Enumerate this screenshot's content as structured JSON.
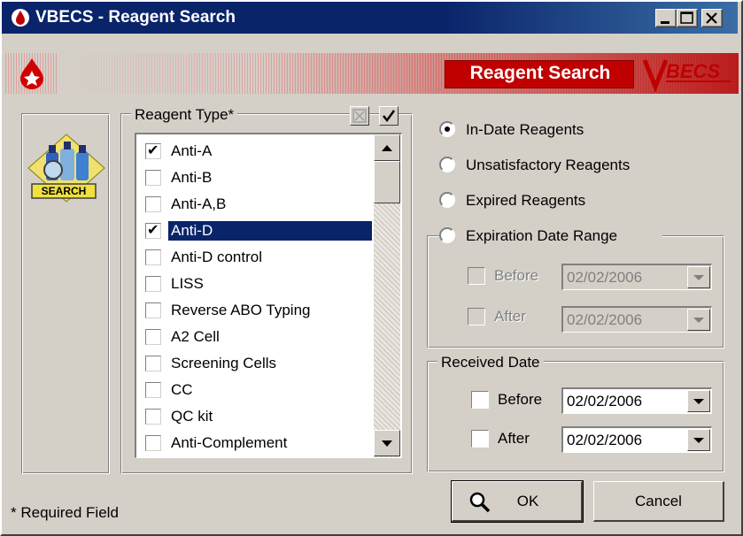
{
  "window": {
    "title": "VBECS - Reagent Search",
    "controls": [
      "minimize",
      "maximize",
      "close"
    ]
  },
  "banner": {
    "title": "Reagent Search",
    "brand": "VBECS"
  },
  "left_panel": {
    "search_button_label": "SEARCH"
  },
  "reagent_type": {
    "legend": "Reagent Type*",
    "items": [
      {
        "label": "Anti-A",
        "checked": true,
        "selected": false
      },
      {
        "label": "Anti-B",
        "checked": false,
        "selected": false
      },
      {
        "label": "Anti-A,B",
        "checked": false,
        "selected": false
      },
      {
        "label": "Anti-D",
        "checked": true,
        "selected": true
      },
      {
        "label": "Anti-D control",
        "checked": false,
        "selected": false
      },
      {
        "label": "LISS",
        "checked": false,
        "selected": false
      },
      {
        "label": "Reverse ABO Typing",
        "checked": false,
        "selected": false
      },
      {
        "label": "A2 Cell",
        "checked": false,
        "selected": false
      },
      {
        "label": "Screening Cells",
        "checked": false,
        "selected": false
      },
      {
        "label": "CC",
        "checked": false,
        "selected": false
      },
      {
        "label": "QC kit",
        "checked": false,
        "selected": false
      },
      {
        "label": "Anti-Complement",
        "checked": false,
        "selected": false
      }
    ]
  },
  "filters": {
    "in_date": "In-Date Reagents",
    "unsatisfactory": "Unsatisfactory Reagents",
    "expired": "Expired Reagents",
    "expiration_range": "Expiration Date Range",
    "selected": "in_date"
  },
  "expiration": {
    "before_label": "Before",
    "before_value": "02/02/2006",
    "after_label": "After",
    "after_value": "02/02/2006"
  },
  "received": {
    "legend": "Received Date",
    "before_label": "Before",
    "before_value": "02/02/2006",
    "after_label": "After",
    "after_value": "02/02/2006"
  },
  "buttons": {
    "ok": "OK",
    "cancel": "Cancel"
  },
  "footer": {
    "required_note": "* Required Field"
  }
}
